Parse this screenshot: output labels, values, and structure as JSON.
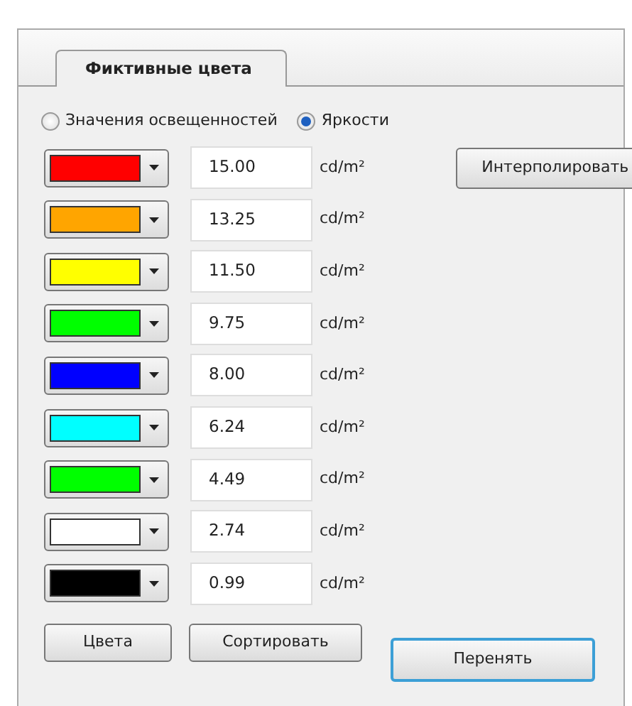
{
  "tabs": [
    {
      "label": "Фиктивные цвета",
      "selected": true
    }
  ],
  "mode_options": [
    {
      "label": "Значения освещенностей",
      "selected": false
    },
    {
      "label": "Яркости",
      "selected": true
    }
  ],
  "levels": [
    {
      "color": "#ff0000",
      "value": "15.00",
      "unit": "cd/m²"
    },
    {
      "color": "#ffa500",
      "value": "13.25",
      "unit": "cd/m²"
    },
    {
      "color": "#ffff00",
      "value": "11.50",
      "unit": "cd/m²"
    },
    {
      "color": "#00ff00",
      "value": "9.75",
      "unit": "cd/m²"
    },
    {
      "color": "#0000ff",
      "value": "8.00",
      "unit": "cd/m²"
    },
    {
      "color": "#00ffff",
      "value": "6.24",
      "unit": "cd/m²"
    },
    {
      "color": "#00ff00",
      "value": "4.49",
      "unit": "cd/m²"
    },
    {
      "color": "#ffffff",
      "value": "2.74",
      "unit": "cd/m²"
    },
    {
      "color": "#000000",
      "value": "0.99",
      "unit": "cd/m²"
    }
  ],
  "interpolate_button": "Интерполировать",
  "bottom_buttons": [
    {
      "label": "Цвета",
      "default": false
    },
    {
      "label": "Сортировать",
      "default": false
    },
    {
      "label": "Перенять",
      "default": true
    }
  ]
}
